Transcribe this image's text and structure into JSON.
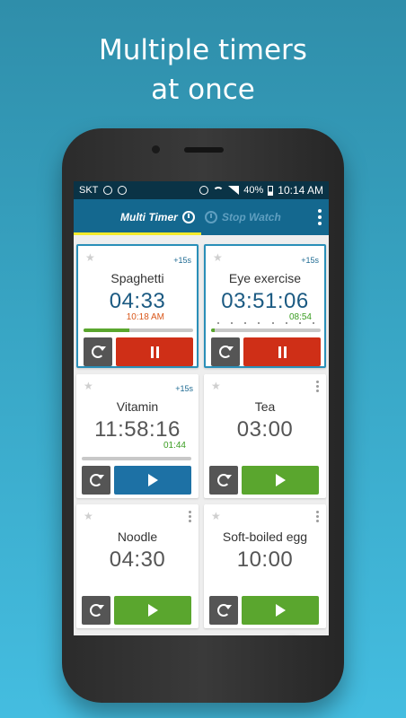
{
  "headline": {
    "line1": "Multiple timers",
    "line2": "at once"
  },
  "status_bar": {
    "carrier": "SKT",
    "battery": "40%",
    "time": "10:14 AM"
  },
  "app_bar": {
    "tabs": [
      {
        "label": "Multi Timer",
        "active": true,
        "icon": "alarm-clock-icon"
      },
      {
        "label": "Stop Watch",
        "active": false,
        "icon": "stopwatch-icon"
      }
    ],
    "menu_icon": "overflow-menu-icon",
    "indicator_color": "#f5ea2c",
    "bar_color": "#14688f"
  },
  "timers": [
    {
      "name": "Spaghetti",
      "time": "04:33",
      "sub": "10:18 AM",
      "add_label": "+15s",
      "state": "running",
      "progress": 0.42,
      "button": "pause"
    },
    {
      "name": "Eye exercise",
      "time": "03:51:06",
      "sub": "08:54",
      "add_label": "+15s",
      "state": "running",
      "progress": 0.03,
      "button": "pause"
    },
    {
      "name": "Vitamin",
      "time": "11:58:16",
      "sub": "01:44",
      "add_label": "+15s",
      "state": "paused",
      "progress": 0.0,
      "button": "play"
    },
    {
      "name": "Tea",
      "time": "03:00",
      "state": "idle",
      "button": "play"
    },
    {
      "name": "Noodle",
      "time": "04:30",
      "state": "idle",
      "button": "play"
    },
    {
      "name": "Soft-boiled egg",
      "time": "10:00",
      "state": "idle",
      "button": "play"
    }
  ],
  "colors": {
    "pause": "#cf2f17",
    "play_paused": "#1d71a5",
    "play_idle": "#5aa62e",
    "sub_time_orange": "#d9571a",
    "sub_time_green": "#3a9d21"
  },
  "fab": {
    "icon": "add-alarm-icon"
  }
}
